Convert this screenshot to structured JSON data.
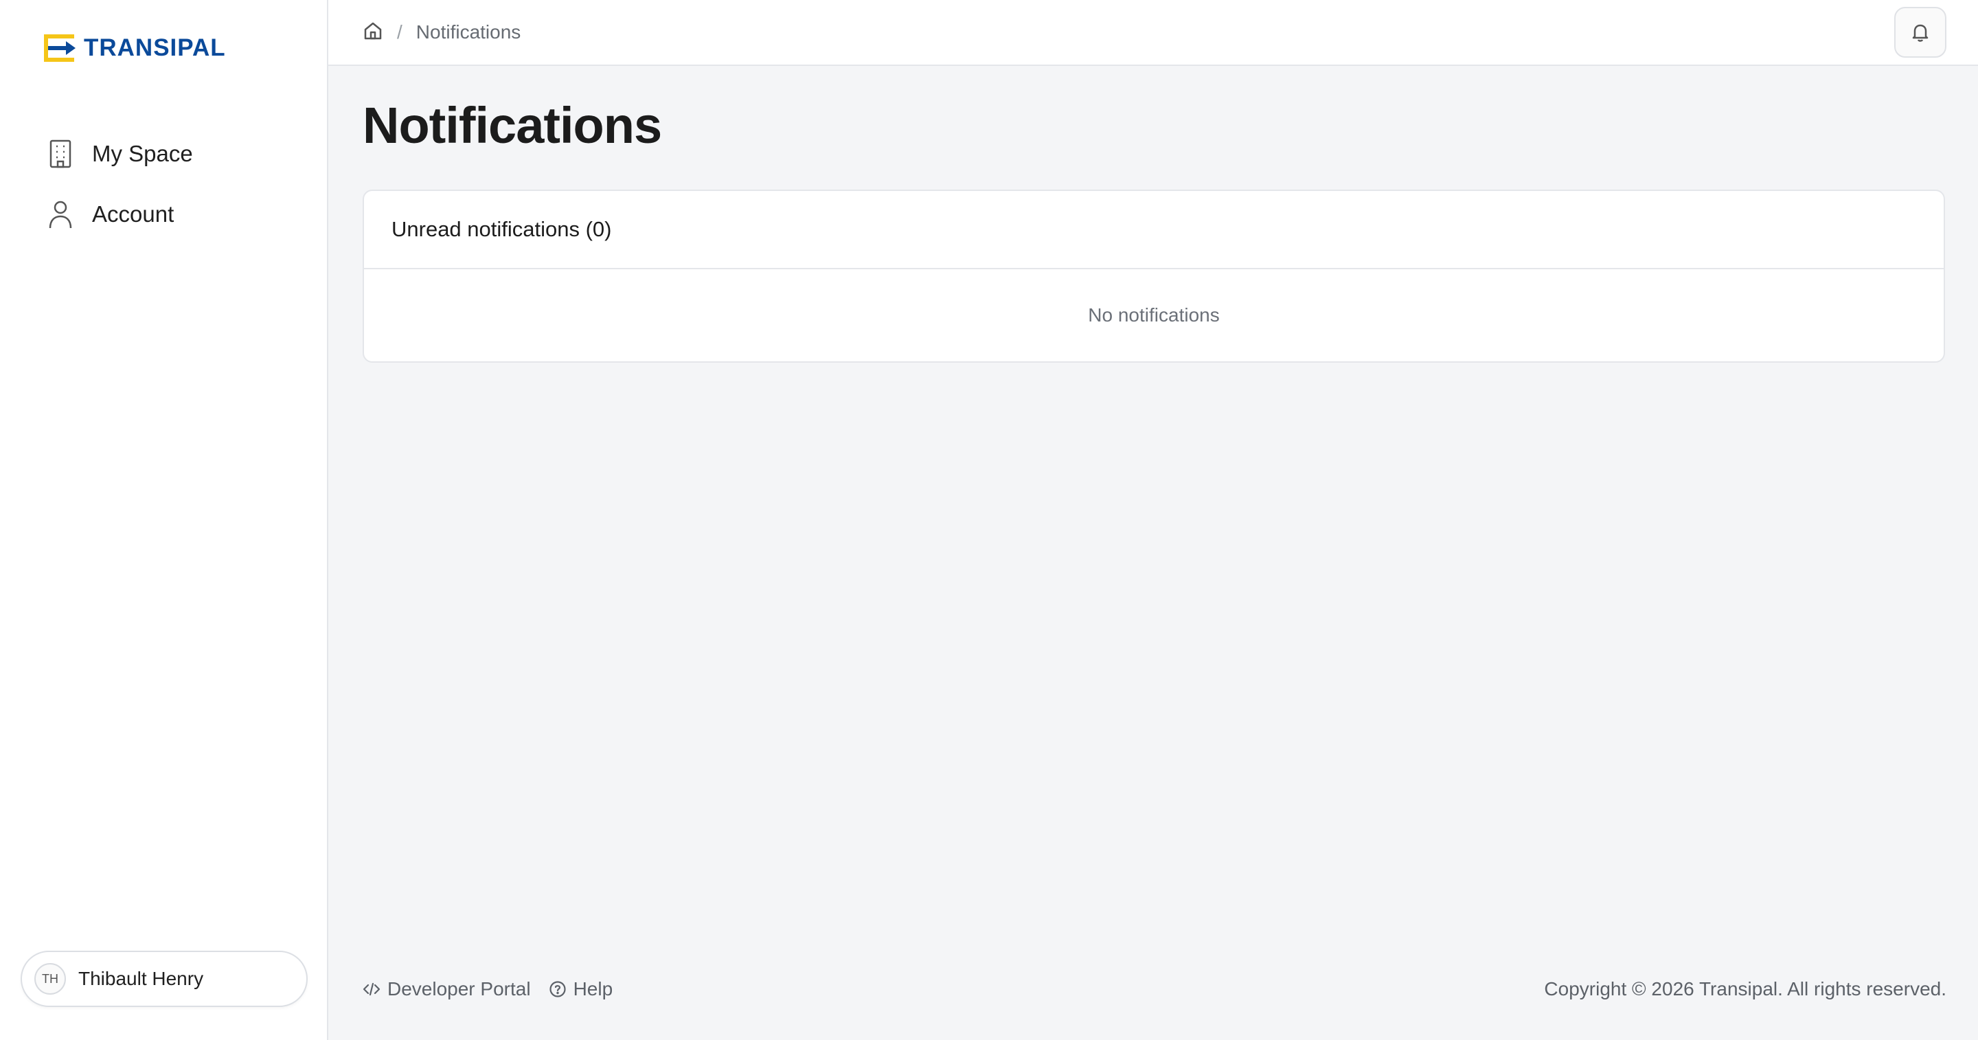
{
  "brand": {
    "name": "TRANSIPAL",
    "primary_color": "#0b4a9a",
    "accent_color": "#f5c518"
  },
  "sidebar": {
    "items": [
      {
        "label": "My Space",
        "icon": "building-icon"
      },
      {
        "label": "Account",
        "icon": "user-icon"
      }
    ],
    "user": {
      "initials": "TH",
      "name": "Thibault Henry"
    }
  },
  "topbar": {
    "breadcrumb": {
      "separator": "/",
      "current": "Notifications"
    }
  },
  "page": {
    "title": "Notifications"
  },
  "card": {
    "title": "Unread notifications (0)",
    "empty_text": "No notifications"
  },
  "footer": {
    "developer_portal": "Developer Portal",
    "help": "Help",
    "copyright": "Copyright © 2026 Transipal. All rights reserved."
  }
}
